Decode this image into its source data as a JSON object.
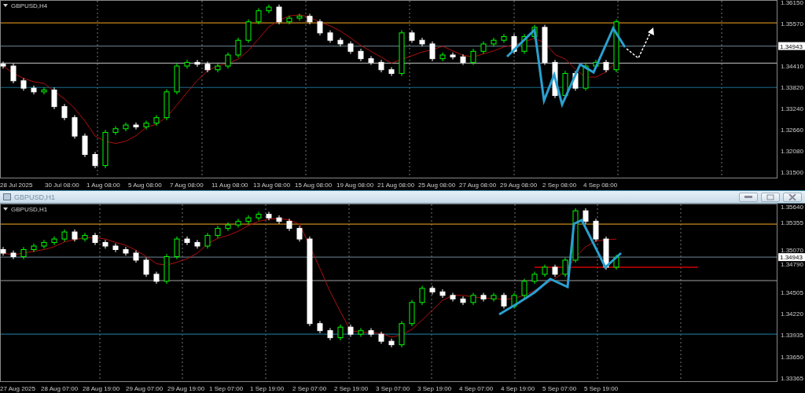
{
  "top_chart": {
    "label": "GBPUSD,H4",
    "current_price": "1.34943",
    "price_labels": [
      "1.36150",
      "1.35570",
      "1.34410",
      "1.33820",
      "1.33240",
      "1.32660",
      "1.32080",
      "1.31500"
    ],
    "time_labels": [
      "28 Jul 2025",
      "30 Jul 08:00",
      "1 Aug 08:00",
      "5 Aug 08:00",
      "7 Aug 08:00",
      "11 Aug 08:00",
      "13 Aug 08:00",
      "15 Aug 08:00",
      "19 Aug 08:00",
      "21 Aug 08:00",
      "25 Aug 08:00",
      "27 Aug 08:00",
      "29 Aug 08:00",
      "2 Sep 08:00",
      "4 Sep 08:00"
    ]
  },
  "bottom_window": {
    "title": "GBPUSD,H1",
    "label": "GBPUSD,H1",
    "current_price": "1.34943",
    "price_labels": [
      "1.35640",
      "1.35355",
      "1.35070",
      "1.34790",
      "1.34505",
      "1.34220",
      "1.33935",
      "1.33650",
      "1.33365"
    ],
    "time_labels": [
      "27 Aug 2025",
      "28 Aug 07:00",
      "28 Aug 19:00",
      "29 Aug 07:00",
      "29 Aug 19:00",
      "1 Sep 07:00",
      "1 Sep 19:00",
      "2 Sep 07:00",
      "2 Sep 19:00",
      "3 Sep 07:00",
      "3 Sep 19:00",
      "4 Sep 07:00",
      "4 Sep 19:00",
      "5 Sep 07:00",
      "5 Sep 19:00"
    ]
  }
}
